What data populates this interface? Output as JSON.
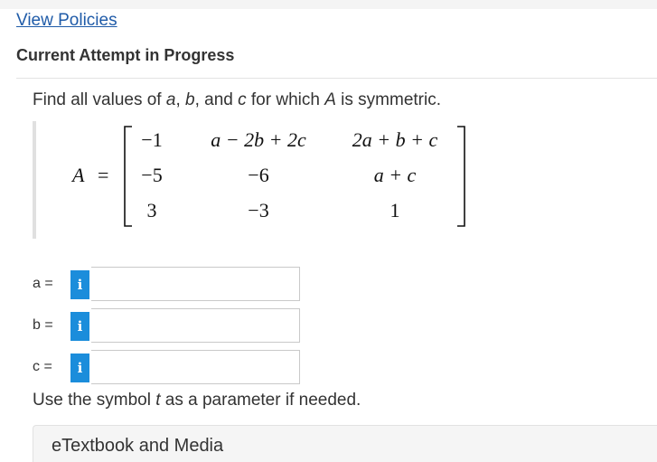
{
  "header": {
    "policies_link": "View Policies",
    "attempt_heading": "Current Attempt in Progress"
  },
  "question": {
    "prefix": "Find all values of ",
    "var_a": "a",
    "sep1": ", ",
    "var_b": "b",
    "sep2": ", and ",
    "var_c": "c",
    "mid": " for which ",
    "var_A": "A",
    "suffix": " is symmetric."
  },
  "matrix": {
    "name": "A",
    "equals": "=",
    "rows": [
      [
        "−1",
        "a − 2b + 2c",
        "2a + b + c"
      ],
      [
        "−5",
        "−6",
        "a + c"
      ],
      [
        "3",
        "−3",
        "1"
      ]
    ]
  },
  "answers": [
    {
      "label": "a =",
      "value": "",
      "info_icon": "info-icon",
      "info_glyph": "i"
    },
    {
      "label": "b =",
      "value": "",
      "info_icon": "info-icon",
      "info_glyph": "i"
    },
    {
      "label": "c =",
      "value": "",
      "info_icon": "info-icon",
      "info_glyph": "i"
    }
  ],
  "hint": {
    "prefix": "Use the symbol ",
    "var_t": "t",
    "suffix": " as a parameter if needed."
  },
  "resources": {
    "etextbook_label": "eTextbook and Media"
  },
  "colors": {
    "link": "#1f5ba8",
    "info_button": "#1b8ddb",
    "text": "#333333"
  }
}
